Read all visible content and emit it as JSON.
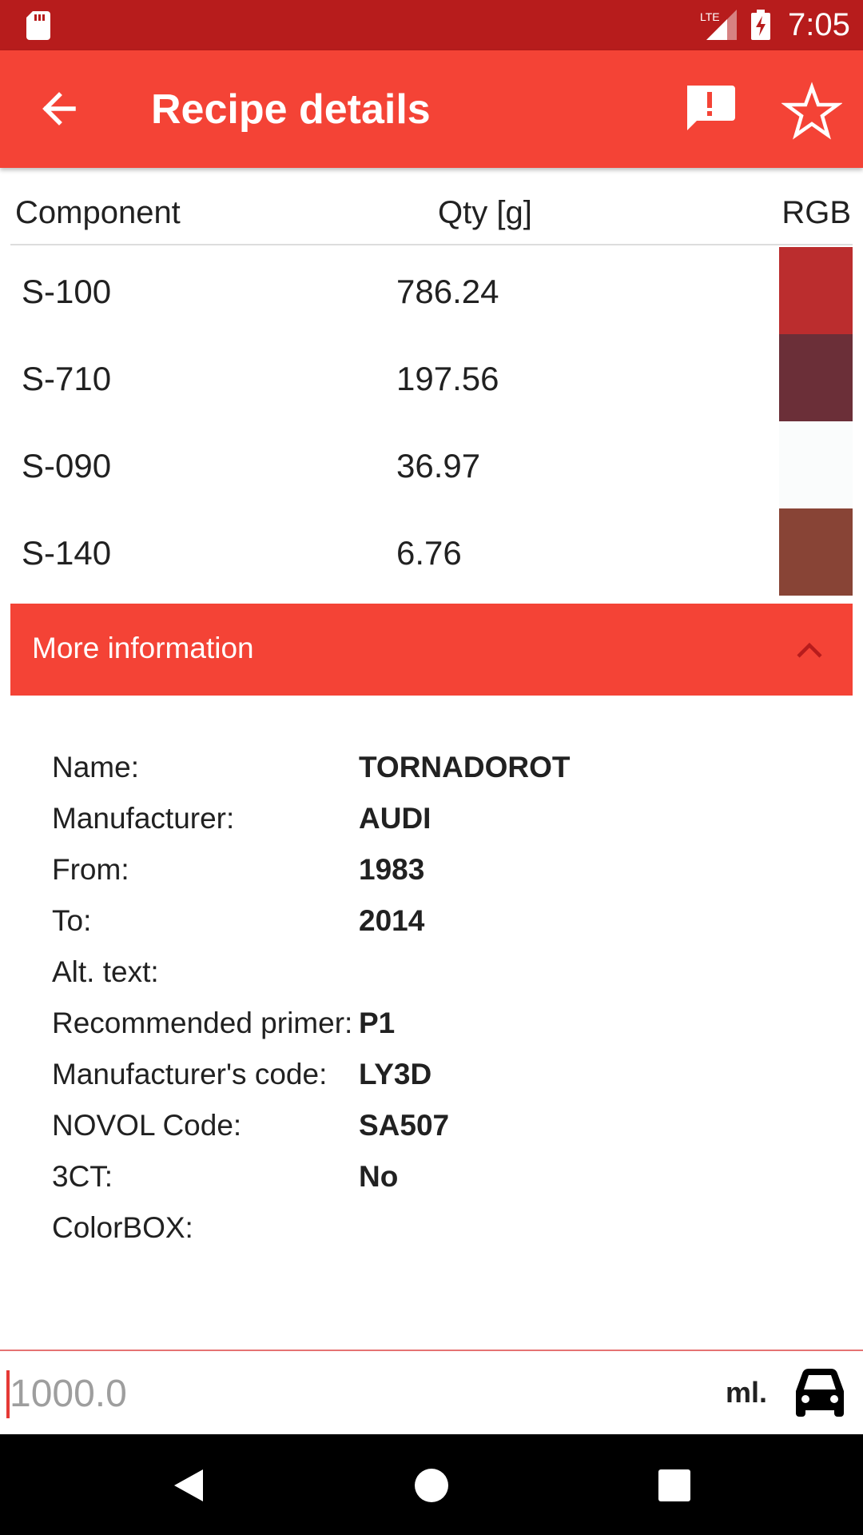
{
  "status_bar": {
    "time": "7:05",
    "network_label": "LTE",
    "icons": [
      "sd-card-icon",
      "lte-signal-icon",
      "battery-charging-icon"
    ]
  },
  "app_bar": {
    "title": "Recipe details",
    "icons": [
      "back-arrow-icon",
      "report-feedback-icon",
      "star-outline-icon"
    ],
    "color": "#f44336"
  },
  "table": {
    "headers": {
      "component": "Component",
      "qty": "Qty [g]",
      "rgb": "RGB"
    },
    "rows": [
      {
        "component": "S-100",
        "qty": "786.24",
        "rgb": "#bb2d2e"
      },
      {
        "component": "S-710",
        "qty": "197.56",
        "rgb": "#6b2f38"
      },
      {
        "component": "S-090",
        "qty": "36.97",
        "rgb": "#fafcfc"
      },
      {
        "component": "S-140",
        "qty": "6.76",
        "rgb": "#884436"
      }
    ]
  },
  "more_info": {
    "label": "More information",
    "icon": "chevron-up-icon",
    "fields": [
      {
        "key": "Name:",
        "value": "TORNADOROT"
      },
      {
        "key": "Manufacturer:",
        "value": "AUDI"
      },
      {
        "key": "From:",
        "value": "1983"
      },
      {
        "key": "To:",
        "value": "2014"
      },
      {
        "key": "Alt. text:",
        "value": ""
      },
      {
        "key": "Recommended primer:",
        "value": "P1"
      },
      {
        "key": "Manufacturer's code:",
        "value": "LY3D"
      },
      {
        "key": "NOVOL Code:",
        "value": "SA507"
      },
      {
        "key": "3CT:",
        "value": "No"
      },
      {
        "key": "ColorBOX:",
        "value": ""
      }
    ]
  },
  "bottom": {
    "placeholder": "1000.0",
    "unit": "ml.",
    "icon": "car-icon"
  },
  "nav_bar": {
    "icons": [
      "nav-back-icon",
      "nav-home-icon",
      "nav-recents-icon"
    ]
  }
}
